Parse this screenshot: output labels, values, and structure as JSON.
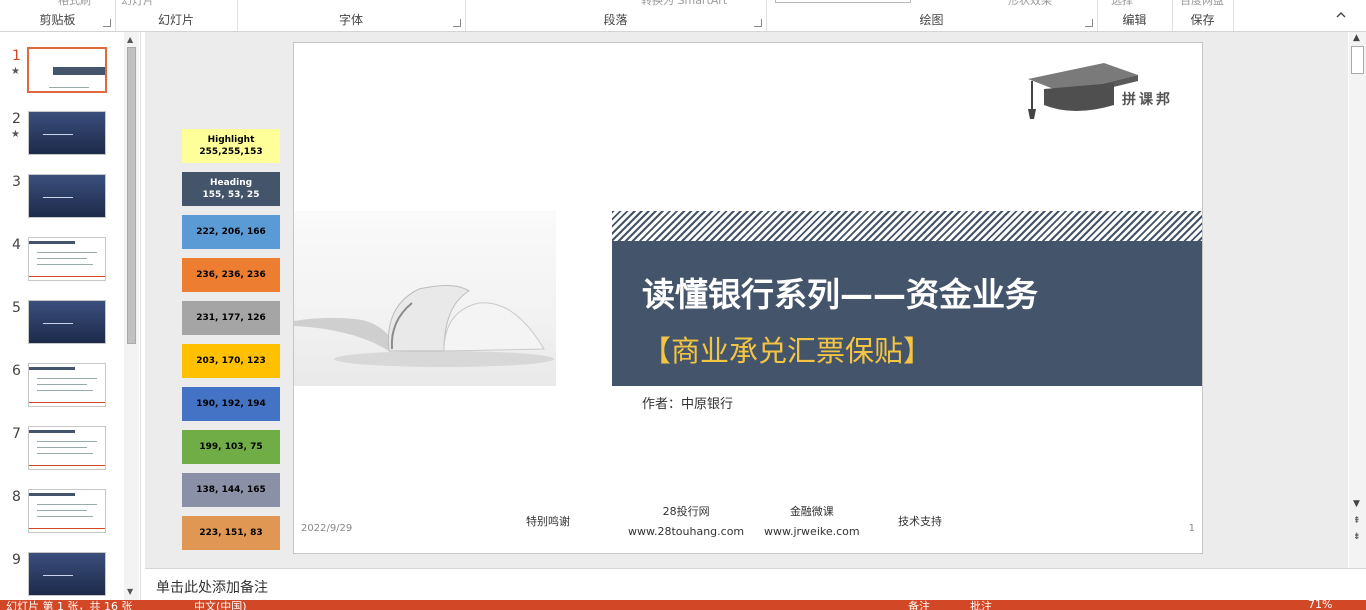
{
  "ribbon": {
    "groups": [
      {
        "label": "剪贴板",
        "cut_text": "格式刷"
      },
      {
        "label": "幻灯片",
        "cut_text": "幻灯片"
      },
      {
        "label": "字体",
        "cut_text": ""
      },
      {
        "label": "段落",
        "cut_text": "转换为 SmartArt"
      },
      {
        "label": "绘图",
        "cut_text": "形状效果"
      },
      {
        "label": "编辑",
        "cut_text": "选择"
      },
      {
        "label": "保存",
        "cut_text": "百度网盘"
      }
    ]
  },
  "thumbnails": [
    {
      "num": "1",
      "star": "★",
      "style": "title",
      "active": true
    },
    {
      "num": "2",
      "star": "★",
      "style": "dark",
      "active": false
    },
    {
      "num": "3",
      "star": "",
      "style": "dark",
      "active": false
    },
    {
      "num": "4",
      "star": "",
      "style": "content",
      "active": false
    },
    {
      "num": "5",
      "star": "",
      "style": "dark",
      "active": false
    },
    {
      "num": "6",
      "star": "",
      "style": "content",
      "active": false
    },
    {
      "num": "7",
      "star": "",
      "style": "content",
      "active": false
    },
    {
      "num": "8",
      "star": "",
      "style": "content",
      "active": false
    },
    {
      "num": "9",
      "star": "",
      "style": "dark",
      "active": false
    }
  ],
  "swatches": [
    {
      "line1": "Highlight",
      "line2": "255,255,153",
      "bg": "#ffff99",
      "fg": "#000000"
    },
    {
      "line1": "Heading",
      "line2": "155, 53, 25",
      "bg": "#44546a",
      "fg": "#ffffff"
    },
    {
      "line1": "",
      "line2": "222, 206, 166",
      "bg": "#5b9bd5",
      "fg": "#000000"
    },
    {
      "line1": "",
      "line2": "236, 236, 236",
      "bg": "#ed7d31",
      "fg": "#000000"
    },
    {
      "line1": "",
      "line2": "231, 177, 126",
      "bg": "#a5a5a5",
      "fg": "#000000"
    },
    {
      "line1": "",
      "line2": "203, 170, 123",
      "bg": "#ffc000",
      "fg": "#000000"
    },
    {
      "line1": "",
      "line2": "190, 192, 194",
      "bg": "#4472c4",
      "fg": "#000000"
    },
    {
      "line1": "",
      "line2": "199, 103, 75",
      "bg": "#70ad47",
      "fg": "#000000"
    },
    {
      "line1": "",
      "line2": "138, 144, 165",
      "bg": "#8a90a5",
      "fg": "#000000"
    },
    {
      "line1": "",
      "line2": "223, 151, 83",
      "bg": "#df9753",
      "fg": "#000000"
    }
  ],
  "slide": {
    "logo_text": "拼课邦",
    "title": "读懂银行系列——资金业务",
    "subtitle": "【商业承兑汇票保贴】",
    "author": "作者：中原银行",
    "date": "2022/9/29",
    "page_number": "1",
    "credits": [
      {
        "line1": "特别鸣谢",
        "line2": ""
      },
      {
        "line1": "28投行网",
        "line2": "www.28touhang.com"
      },
      {
        "line1": "金融微课",
        "line2": "www.jrweike.com"
      },
      {
        "line1": "技术支持",
        "line2": ""
      }
    ]
  },
  "notes": {
    "placeholder": "单击此处添加备注"
  },
  "status": {
    "slide_info": "幻灯片 第 1 张，共 16 张",
    "language": "中文(中国)",
    "notes_btn": "备注",
    "comments_btn": "批注",
    "zoom": "71%"
  },
  "colors": {
    "accent": "#d24726",
    "title_band": "#44546a",
    "subtitle": "#f4c542"
  }
}
